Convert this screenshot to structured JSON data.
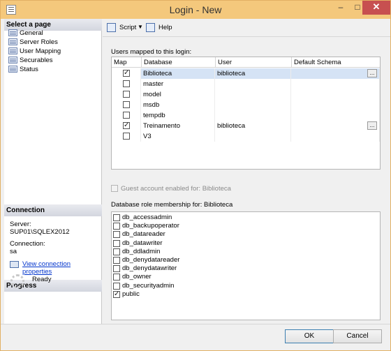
{
  "window": {
    "title": "Login - New",
    "controls": {
      "minimize": "–",
      "maximize": "□",
      "close": "✕"
    }
  },
  "sidebar": {
    "select_page_header": "Select a page",
    "pages": [
      {
        "label": "General",
        "icon": "page-icon"
      },
      {
        "label": "Server Roles",
        "icon": "page-icon"
      },
      {
        "label": "User Mapping",
        "icon": "page-icon"
      },
      {
        "label": "Securables",
        "icon": "page-icon"
      },
      {
        "label": "Status",
        "icon": "page-icon"
      }
    ],
    "connection_header": "Connection",
    "server_label": "Server:",
    "server_value": "SUP01\\SQLEX2012",
    "connection_label": "Connection:",
    "connection_value": "sa",
    "view_connection_link": "View connection properties",
    "progress_header": "Progress",
    "progress_status": "Ready"
  },
  "toolbar": {
    "script_label": "Script",
    "help_label": "Help"
  },
  "users_mapped": {
    "label": "Users mapped to this login:",
    "columns": [
      "Map",
      "Database",
      "User",
      "Default Schema"
    ],
    "rows": [
      {
        "map": true,
        "database": "Biblioteca",
        "user": "biblioteca",
        "schema": "",
        "selected": true,
        "has_ellipsis": true
      },
      {
        "map": false,
        "database": "master",
        "user": "",
        "schema": ""
      },
      {
        "map": false,
        "database": "model",
        "user": "",
        "schema": ""
      },
      {
        "map": false,
        "database": "msdb",
        "user": "",
        "schema": ""
      },
      {
        "map": false,
        "database": "tempdb",
        "user": "",
        "schema": ""
      },
      {
        "map": true,
        "database": "Treinamento",
        "user": "biblioteca",
        "schema": "",
        "has_ellipsis": true
      },
      {
        "map": false,
        "database": "V3",
        "user": "",
        "schema": ""
      }
    ],
    "ellipsis_label": "..."
  },
  "guest": {
    "label": "Guest account enabled for: Biblioteca",
    "checked": false,
    "enabled": false
  },
  "roles": {
    "label": "Database role membership for: Biblioteca",
    "items": [
      {
        "label": "db_accessadmin",
        "checked": false
      },
      {
        "label": "db_backupoperator",
        "checked": false
      },
      {
        "label": "db_datareader",
        "checked": false
      },
      {
        "label": "db_datawriter",
        "checked": false
      },
      {
        "label": "db_ddladmin",
        "checked": false
      },
      {
        "label": "db_denydatareader",
        "checked": false
      },
      {
        "label": "db_denydatawriter",
        "checked": false
      },
      {
        "label": "db_owner",
        "checked": false
      },
      {
        "label": "db_securityadmin",
        "checked": false
      },
      {
        "label": "public",
        "checked": true
      }
    ]
  },
  "buttons": {
    "ok": "OK",
    "cancel": "Cancel"
  },
  "colors": {
    "titlebar": "#f4c87c",
    "close_button": "#c75050",
    "link": "#0033cc",
    "selection": "#d5e3f5"
  }
}
